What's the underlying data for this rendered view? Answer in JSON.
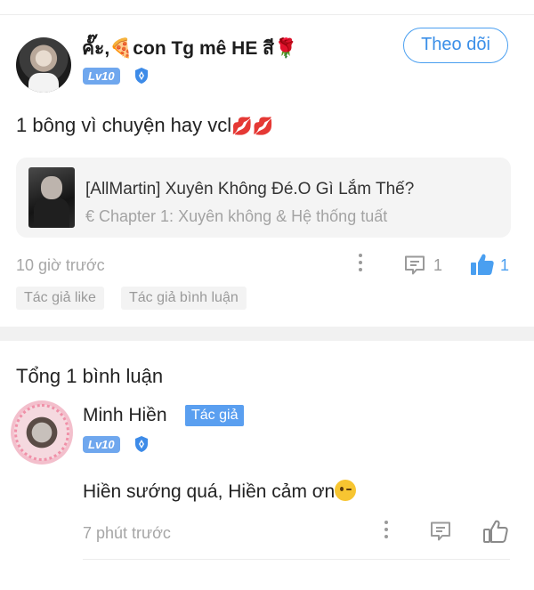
{
  "post": {
    "username": "คั๊ะ,🍕con Tg mê HE สี🌹",
    "level": "Lv10",
    "follow_label": "Theo dõi",
    "content_text": "1 bông vì chuyện hay vcl",
    "content_emoji": "💋💋",
    "book": {
      "title": "[AllMartin] Xuyên Không Đé.O Gì Lắm Thế?",
      "chapter": "€ Chapter 1: Xuyên không & Hệ thống tuất"
    },
    "time": "10 giờ trước",
    "comment_count": "1",
    "like_count": "1",
    "tags": [
      "Tác giả like",
      "Tác giả bình luận"
    ]
  },
  "comments_section": {
    "total_label": "Tổng 1 bình luận",
    "comments": [
      {
        "name": "Minh Hiền",
        "badge": "Tác giả",
        "level": "Lv10",
        "text": "Hiền sướng quá, Hiền cảm ơn",
        "emoji": "wink-emoji",
        "time": "7 phút trước"
      }
    ]
  },
  "colors": {
    "accent_blue": "#4a9ff0",
    "level_badge": "#6fa7ee",
    "muted_text": "#a6a6a6",
    "card_bg": "#f4f4f4",
    "lips_red": "#e0243c"
  },
  "icons": [
    "shield-icon",
    "more-icon",
    "comment-icon",
    "thumbs-up-icon"
  ]
}
